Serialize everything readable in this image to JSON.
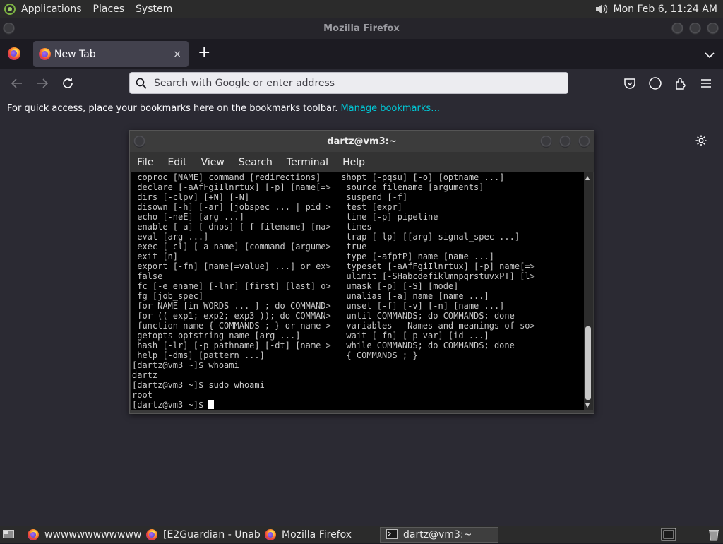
{
  "top_panel": {
    "menus": [
      "Applications",
      "Places",
      "System"
    ],
    "clock": "Mon Feb  6, 11:24 AM"
  },
  "firefox": {
    "window_title": "Mozilla Firefox",
    "tab": {
      "label": "New Tab",
      "close": "×"
    },
    "new_tab_glyph": "+",
    "url_placeholder": "Search with Google or enter address",
    "url_value": "",
    "bookmarks_message": "For quick access, place your bookmarks here on the bookmarks toolbar.",
    "bookmarks_link": "Manage bookmarks…"
  },
  "terminal": {
    "title": "dartz@vm3:~",
    "menu": [
      "File",
      "Edit",
      "View",
      "Search",
      "Terminal",
      "Help"
    ],
    "lines": [
      " coproc [NAME] command [redirections]    shopt [-pqsu] [-o] [optname ...]",
      " declare [-aAfFgiIlnrtux] [-p] [name[=>   source filename [arguments]",
      " dirs [-clpv] [+N] [-N]                   suspend [-f]",
      " disown [-h] [-ar] [jobspec ... | pid >   test [expr]",
      " echo [-neE] [arg ...]                    time [-p] pipeline",
      " enable [-a] [-dnps] [-f filename] [na>   times",
      " eval [arg ...]                           trap [-lp] [[arg] signal_spec ...]",
      " exec [-cl] [-a name] [command [argume>   true",
      " exit [n]                                 type [-afptP] name [name ...]",
      " export [-fn] [name[=value] ...] or ex>   typeset [-aAfFgiIlnrtux] [-p] name[=>",
      " false                                    ulimit [-SHabcdefiklmnpqrstuvxPT] [l>",
      " fc [-e ename] [-lnr] [first] [last] o>   umask [-p] [-S] [mode]",
      " fg [job_spec]                            unalias [-a] name [name ...]",
      " for NAME [in WORDS ... ] ; do COMMAND>   unset [-f] [-v] [-n] [name ...]",
      " for (( exp1; exp2; exp3 )); do COMMAN>   until COMMANDS; do COMMANDS; done",
      " function name { COMMANDS ; } or name >   variables - Names and meanings of so>",
      " getopts optstring name [arg ...]         wait [-fn] [-p var] [id ...]",
      " hash [-lr] [-p pathname] [-dt] [name >   while COMMANDS; do COMMANDS; done",
      " help [-dms] [pattern ...]                { COMMANDS ; }",
      "[dartz@vm3 ~]$ whoami",
      "dartz",
      "[dartz@vm3 ~]$ sudo whoami",
      "root",
      "[dartz@vm3 ~]$ "
    ]
  },
  "taskbar": {
    "items": [
      {
        "label": "wwwwwwwwwwwwww...",
        "icon": "firefox-icon",
        "active": false
      },
      {
        "label": "[E2Guardian - Unab...",
        "icon": "firefox-icon",
        "active": false
      },
      {
        "label": "Mozilla Firefox",
        "icon": "firefox-icon",
        "active": false
      },
      {
        "label": "dartz@vm3:~",
        "icon": "terminal-icon",
        "active": true
      }
    ]
  },
  "colors": {
    "firefox_dark": "#2b2a33",
    "link": "#00c8d7",
    "terminal_bg": "#000000",
    "terminal_fg": "#c8c8c8"
  }
}
